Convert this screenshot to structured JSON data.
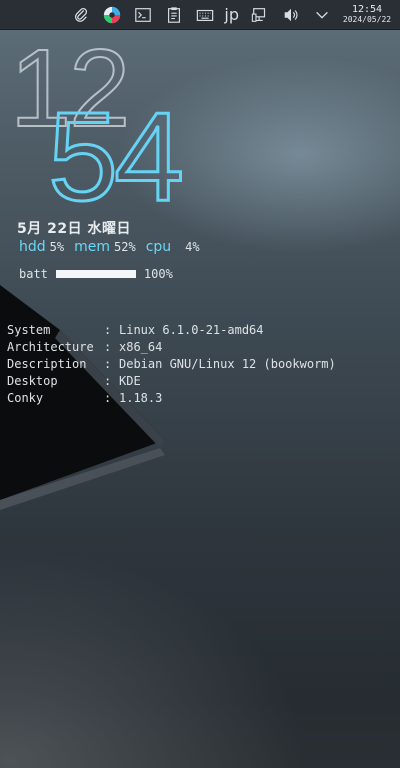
{
  "panel": {
    "tray": [
      {
        "name": "paperclip-icon"
      },
      {
        "name": "app-launcher-icon"
      },
      {
        "name": "terminal-icon"
      },
      {
        "name": "clipboard-icon"
      },
      {
        "name": "keyboard-icon"
      }
    ],
    "input_method": "jp",
    "tray_after": [
      {
        "name": "network-icon"
      },
      {
        "name": "volume-icon"
      },
      {
        "name": "chevron-down-icon"
      }
    ],
    "clock_time": "12:54",
    "clock_date": "2024/05/22"
  },
  "conky": {
    "hour": "12",
    "minute": "54",
    "date": "5月 22日 水曜日",
    "stats": {
      "hdd_label": "hdd",
      "hdd_value": "5%",
      "mem_label": "mem",
      "mem_value": "52%",
      "cpu_label": "cpu",
      "cpu_value": "4%"
    },
    "battery": {
      "label": "batt",
      "percent_text": "100%",
      "level": 1.0
    },
    "sysinfo": [
      {
        "key": "System",
        "value": "Linux 6.1.0-21-amd64"
      },
      {
        "key": "Architecture",
        "value": "x86_64"
      },
      {
        "key": "Description",
        "value": "Debian GNU/Linux 12 (bookworm)"
      },
      {
        "key": "Desktop",
        "value": "KDE"
      },
      {
        "key": "Conky",
        "value": "1.18.3"
      }
    ],
    "separator": ":"
  },
  "colors": {
    "accent": "#66d3f4",
    "panel_bg": "#2a2f36"
  }
}
